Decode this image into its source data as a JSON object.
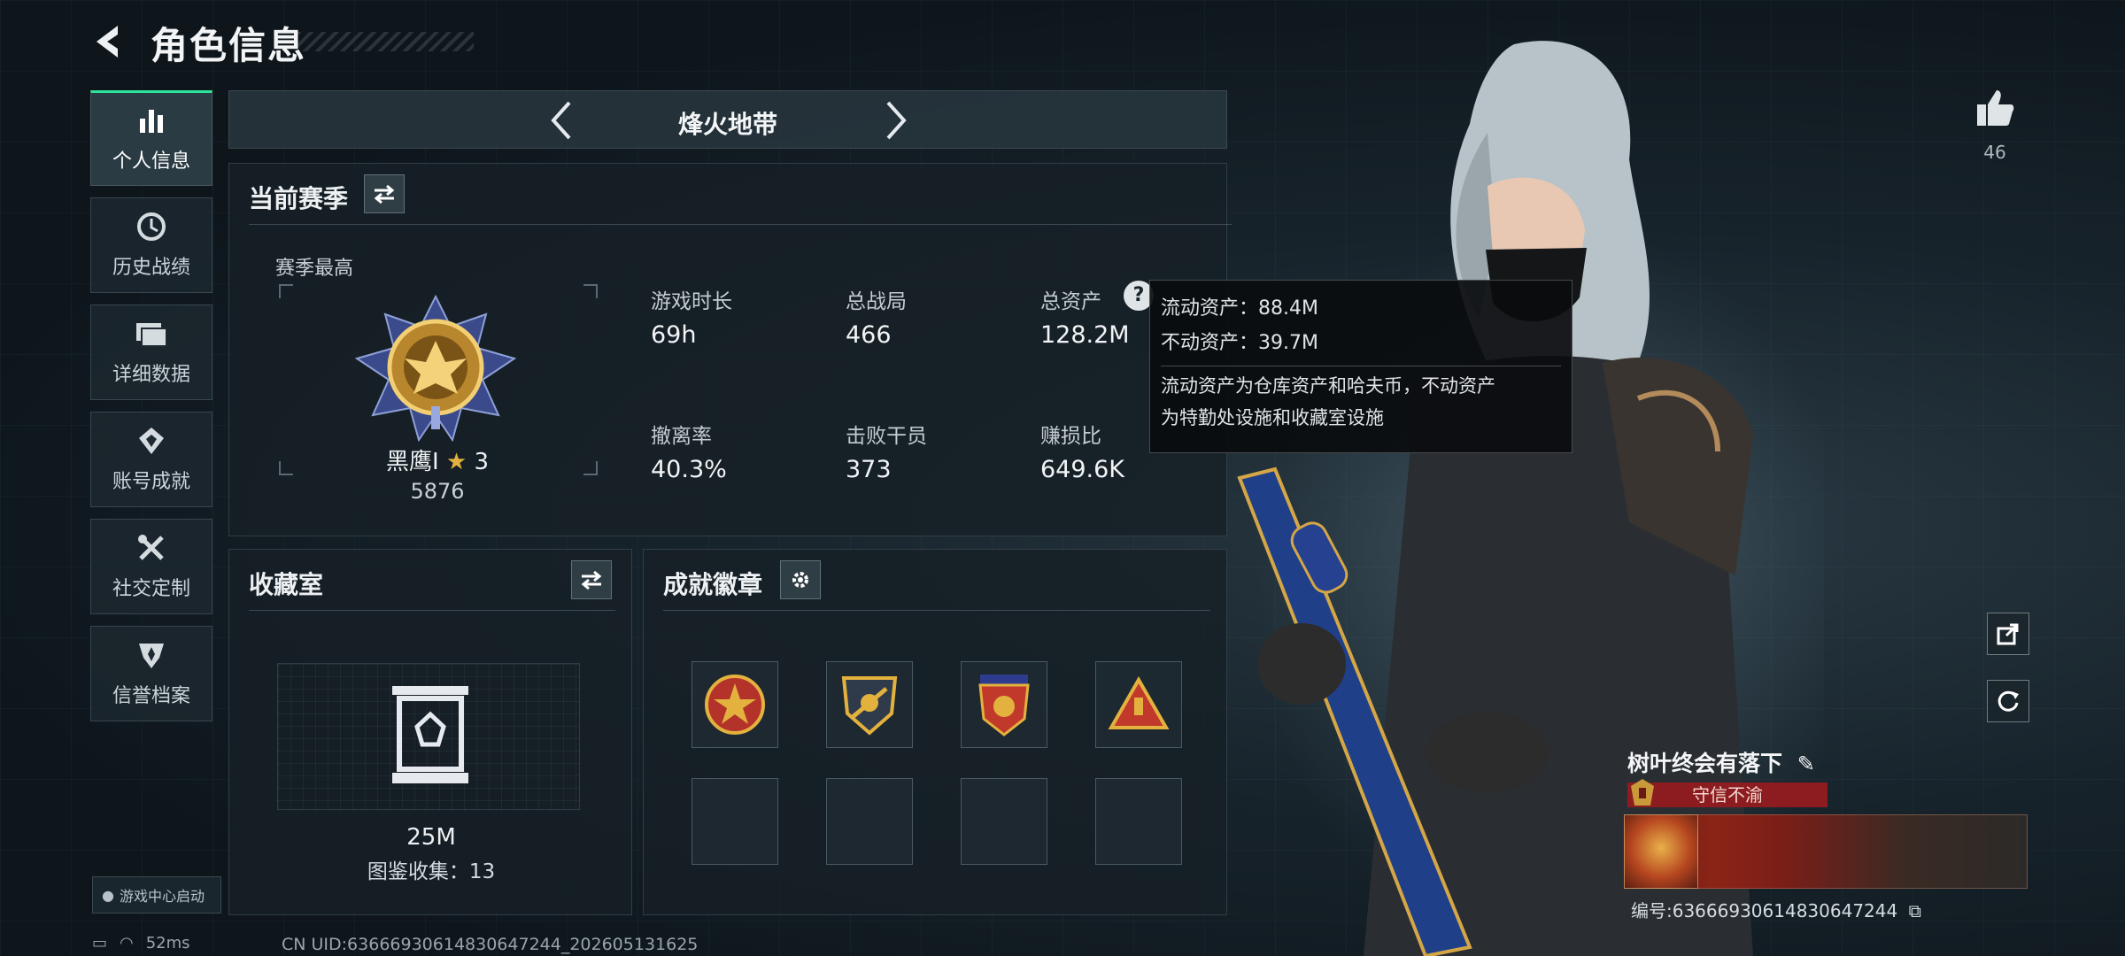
{
  "header": {
    "title": "角色信息"
  },
  "sidebar": {
    "items": [
      {
        "label": "个人信息",
        "icon": "bar-chart-icon"
      },
      {
        "label": "历史战绩",
        "icon": "history-icon"
      },
      {
        "label": "详细数据",
        "icon": "folder-icon"
      },
      {
        "label": "账号成就",
        "icon": "achievement-icon"
      },
      {
        "label": "社交定制",
        "icon": "tools-icon"
      },
      {
        "label": "信誉档案",
        "icon": "reputation-icon"
      }
    ],
    "launch_label": "游戏中心启动"
  },
  "mode": {
    "title": "烽火地带"
  },
  "season": {
    "title": "当前赛季",
    "best_label": "赛季最高",
    "rank_name": "黑鹰Ⅰ",
    "rank_stars": "3",
    "rank_points": "5876",
    "stats": [
      {
        "label": "游戏时长",
        "value": "69h"
      },
      {
        "label": "总战局",
        "value": "466"
      },
      {
        "label": "总资产",
        "value": "128.2M"
      },
      {
        "label": "撤离率",
        "value": "40.3%"
      },
      {
        "label": "击败干员",
        "value": "373"
      },
      {
        "label": "赚损比",
        "value": "649.6K"
      }
    ]
  },
  "tooltip": {
    "liquid": "流动资产：88.4M",
    "fixed": "不动资产：39.7M",
    "desc_line1": "流动资产为仓库资产和哈夫币，不动资产",
    "desc_line2": "为特勤处设施和收藏室设施"
  },
  "collection": {
    "title": "收藏室",
    "value": "25M",
    "catalog": "图鉴收集：13"
  },
  "badges": {
    "title": "成就徽章"
  },
  "profile": {
    "likes": "46",
    "name": "树叶终会有落下",
    "honor": "守信不渝",
    "id_line": "编号:636669306148306472​44"
  },
  "status": {
    "ping": "52ms",
    "cn_uid": "CN UID:636669306148306​47244_202605131625"
  },
  "colors": {
    "accent_green": "#2fe39a",
    "honor_red": "#8c1c1f",
    "gold": "#d9a441"
  }
}
